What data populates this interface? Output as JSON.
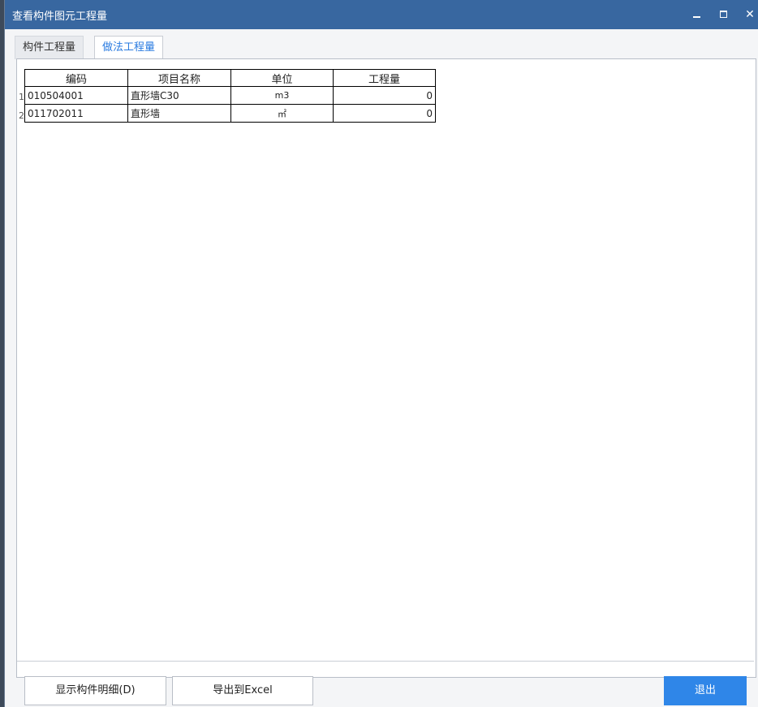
{
  "window": {
    "title": "查看构件图元工程量",
    "min_icon": "minimize-icon",
    "max_icon": "maximize-icon",
    "close_glyph": "✕"
  },
  "tabs": [
    {
      "label": "构件工程量",
      "active": false
    },
    {
      "label": "做法工程量",
      "active": true
    }
  ],
  "table": {
    "headers": [
      "编码",
      "项目名称",
      "单位",
      "工程量"
    ],
    "rows": [
      {
        "num": "1",
        "code": "010504001",
        "name": "直形墙C30",
        "unit": "m3",
        "qty": "0"
      },
      {
        "num": "2",
        "code": "011702011",
        "name": "直形墙",
        "unit": "㎡",
        "qty": "0"
      }
    ]
  },
  "buttons": {
    "detail": "显示构件明细(D)",
    "export": "导出到Excel",
    "exit": "退出"
  },
  "colors": {
    "titlebar": "#3867a0",
    "active_tab": "#2a7be0",
    "exit_button": "#2f86e8"
  }
}
